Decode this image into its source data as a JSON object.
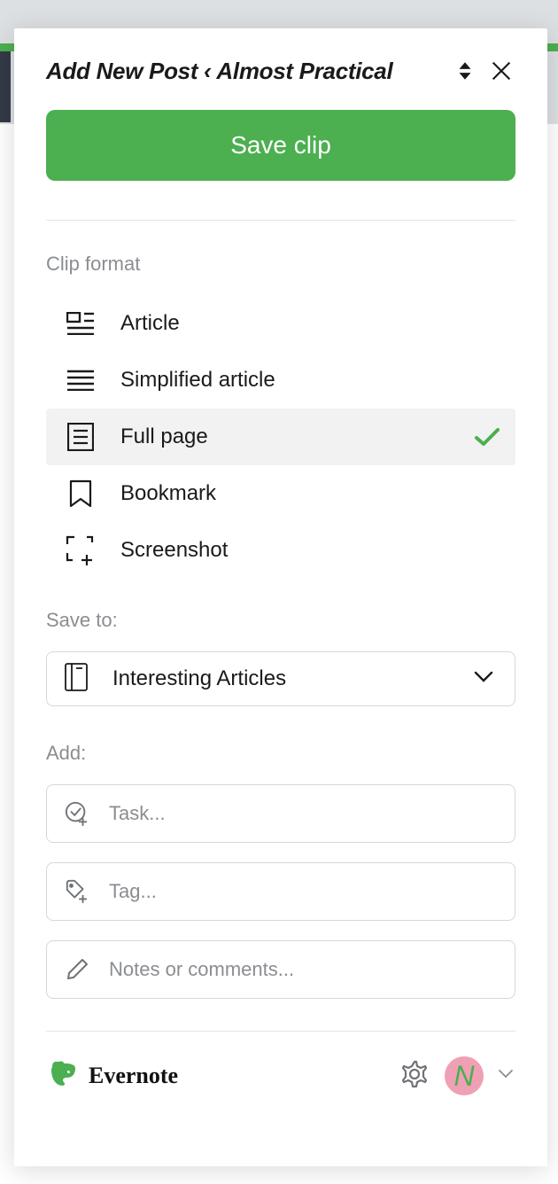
{
  "header": {
    "title": "Add New Post ‹ Almost Practical"
  },
  "save_button_label": "Save clip",
  "clip_format": {
    "label": "Clip format",
    "options": [
      {
        "label": "Article"
      },
      {
        "label": "Simplified article"
      },
      {
        "label": "Full page",
        "selected": true
      },
      {
        "label": "Bookmark"
      },
      {
        "label": "Screenshot"
      }
    ]
  },
  "save_to": {
    "label": "Save to:",
    "notebook": "Interesting Articles"
  },
  "add": {
    "label": "Add:",
    "task_placeholder": "Task...",
    "tag_placeholder": "Tag...",
    "notes_placeholder": "Notes or comments..."
  },
  "footer": {
    "brand": "Evernote",
    "avatar_initial": "N"
  },
  "colors": {
    "accent": "#4caf50"
  }
}
